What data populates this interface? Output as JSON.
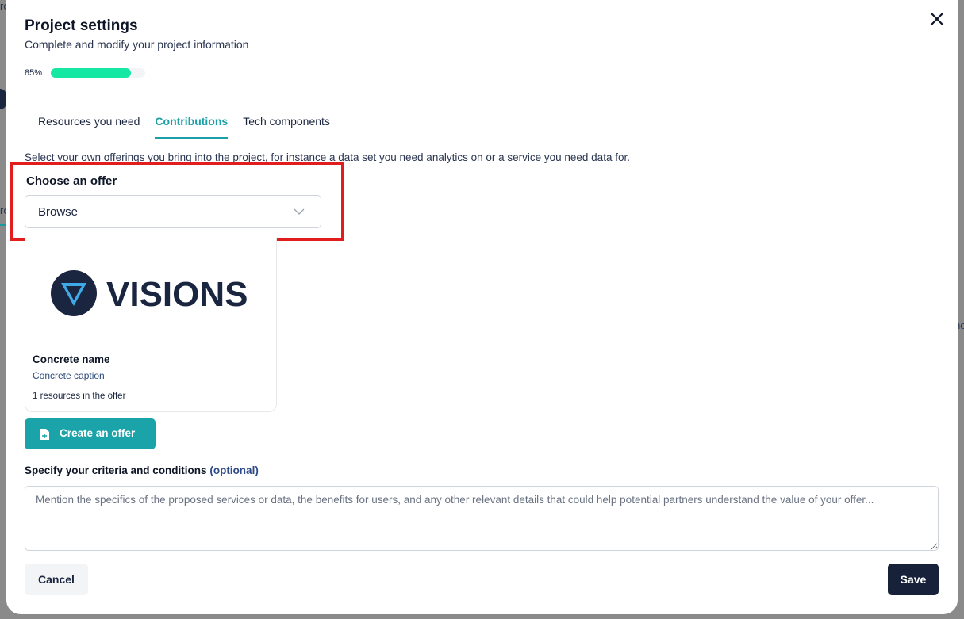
{
  "backdrop": {
    "frag_top": "ro",
    "frag_left": "ro",
    "frag_right": "no"
  },
  "modal": {
    "title": "Project settings",
    "subtitle": "Complete and modify your project information",
    "close_icon": "close-icon"
  },
  "progress": {
    "label": "85%",
    "value_fraction": 0.85,
    "fill_color": "#14e8a3"
  },
  "tabs": [
    {
      "label": "Resources you need",
      "active": false
    },
    {
      "label": "Contributions",
      "active": true
    },
    {
      "label": "Tech components",
      "active": false
    }
  ],
  "description": "Select your own offerings you bring into the project, for instance a data set you need analytics on or a service you need data for.",
  "offer": {
    "label": "Choose an offer",
    "select_value": "Browse"
  },
  "card": {
    "logo_text": "VISIONS",
    "name": "Concrete name",
    "caption": "Concrete caption",
    "count": "1 resources in the offer"
  },
  "create_button": {
    "label": "Create an offer",
    "icon": "file-plus-icon"
  },
  "criteria": {
    "label": "Specify your criteria and conditions",
    "optional": "(optional)",
    "placeholder": "Mention the specifics of the proposed services or data, the benefits for users, and any other relevant details that could help potential partners understand the value of your offer..."
  },
  "footer": {
    "cancel_label": "Cancel",
    "save_label": "Save"
  },
  "colors": {
    "accent": "#1aa3a8",
    "primary_dark": "#17213a",
    "highlight": "#e21d1d"
  }
}
